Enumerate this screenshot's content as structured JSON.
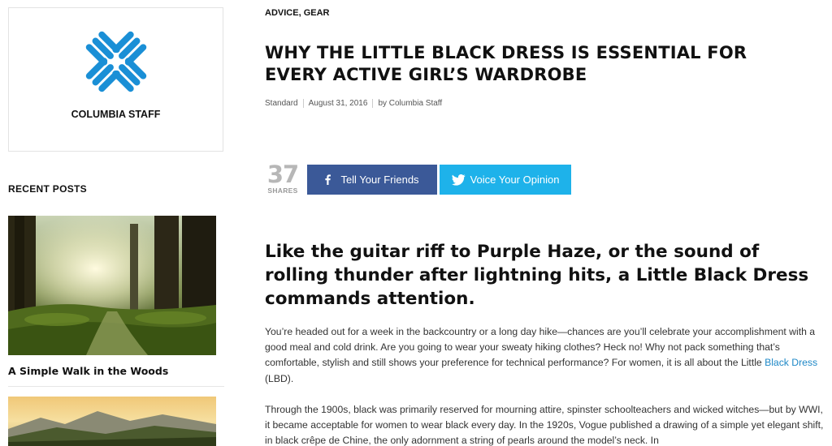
{
  "sidebar": {
    "author": {
      "name": "COLUMBIA STAFF",
      "logo_icon": "columbia-diamond-logo-icon",
      "logo_color": "#1a8fd6"
    },
    "recent_posts": {
      "heading": "RECENT POSTS",
      "items": [
        {
          "title": "A Simple Walk in the Woods",
          "image": "forest-path-photo"
        },
        {
          "title": "",
          "image": "mountain-landscape-photo"
        }
      ]
    }
  },
  "article": {
    "categories": [
      "ADVICE",
      "GEAR"
    ],
    "category_separator": ", ",
    "title": "WHY THE LITTLE BLACK DRESS IS ESSENTIAL FOR EVERY ACTIVE GIRL’S WARDROBE",
    "meta": {
      "format": "Standard",
      "date": "August 31, 2016",
      "author": "by Columbia Staff"
    },
    "share": {
      "count": "37",
      "count_label": "SHARES",
      "facebook_label": "Tell Your Friends",
      "facebook_icon": "facebook-icon",
      "facebook_color": "#3b5998",
      "twitter_label": "Voice Your Opinion",
      "twitter_icon": "twitter-bird-icon",
      "twitter_color": "#1eb2ea"
    },
    "lede": "Like the guitar riff to Purple Haze, or the sound of rolling thunder after lightning hits, a Little Black Dress commands attention.",
    "paragraph_1": {
      "text_before": "You’re headed out for a week in the backcountry or a long day hike—chances are you’ll celebrate your accomplishment with a good meal and cold drink. Are you going to wear your sweaty hiking clothes? Heck no! Why not pack something that’s comfortable, stylish and still shows your preference for technical performance? For women, it is all about the Little ",
      "link_text": "Black Dress",
      "text_after": " (LBD).",
      "link_color": "#1e88c7"
    },
    "paragraph_2": "Through the 1900s, black was primarily reserved for mourning attire, spinster schoolteachers and wicked witches—but by WWI, it became acceptable for women to wear black every day. In the 1920s, Vogue published a drawing of a simple yet elegant shift, in black crêpe de Chine, the only adornment a string of pearls around the model’s neck. In"
  }
}
